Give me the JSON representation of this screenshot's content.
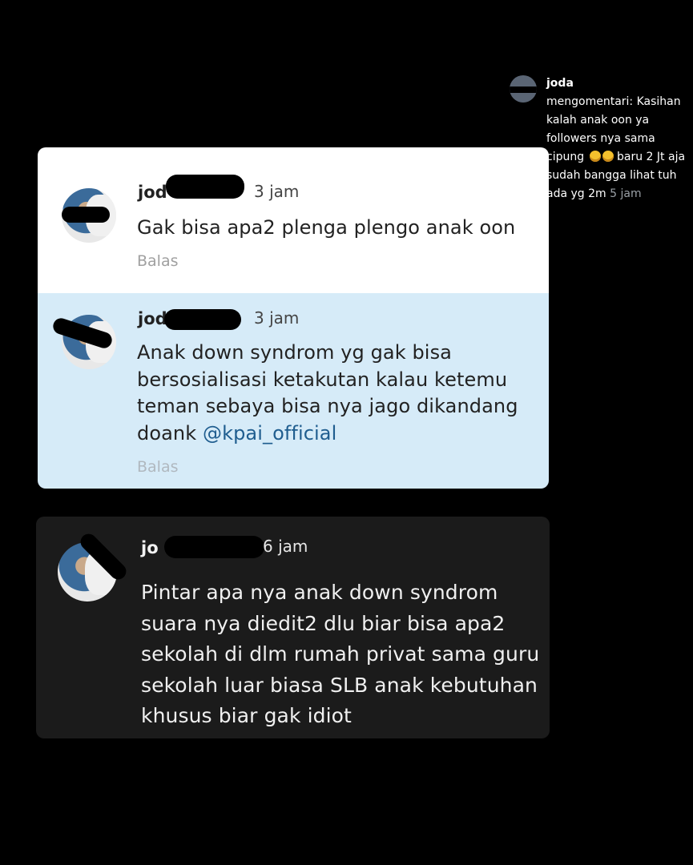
{
  "notification": {
    "username": "joda",
    "body_line": "mengomentari: Kasihan kalah anak oon ya followers nya sama cipung",
    "body_after": "baru 2 Jt aja sudah bangga lihat tuh ada yg 2m",
    "time": "5 jam",
    "emoji_count": 2,
    "emoji_icon": "rofl-emoji-icon"
  },
  "comments": [
    {
      "username": "jod",
      "time": "3 jam",
      "text": "Gak bisa apa2 plenga plengo anak oon",
      "reply": "Balas",
      "bg": "#ffffff"
    },
    {
      "username": "jod",
      "time": "3 jam",
      "text_lines": [
        "Anak down syndrom yg gak bisa",
        "bersosialisasi ketakutan kalau ketemu",
        "teman sebaya bisa nya jago dikandang"
      ],
      "text_last": "doank",
      "mention": "@kpai_official",
      "reply": "Balas",
      "bg": "#d6ebf8"
    },
    {
      "username": "jo",
      "time": "6 jam",
      "text_lines": [
        "Pintar apa nya anak down syndrom",
        "suara nya diedit2 dlu biar bisa apa2",
        "sekolah di dlm rumah privat sama guru",
        "sekolah luar biasa SLB anak kebutuhan",
        "khusus biar gak idiot"
      ],
      "bg": "#1b1b1b"
    }
  ]
}
